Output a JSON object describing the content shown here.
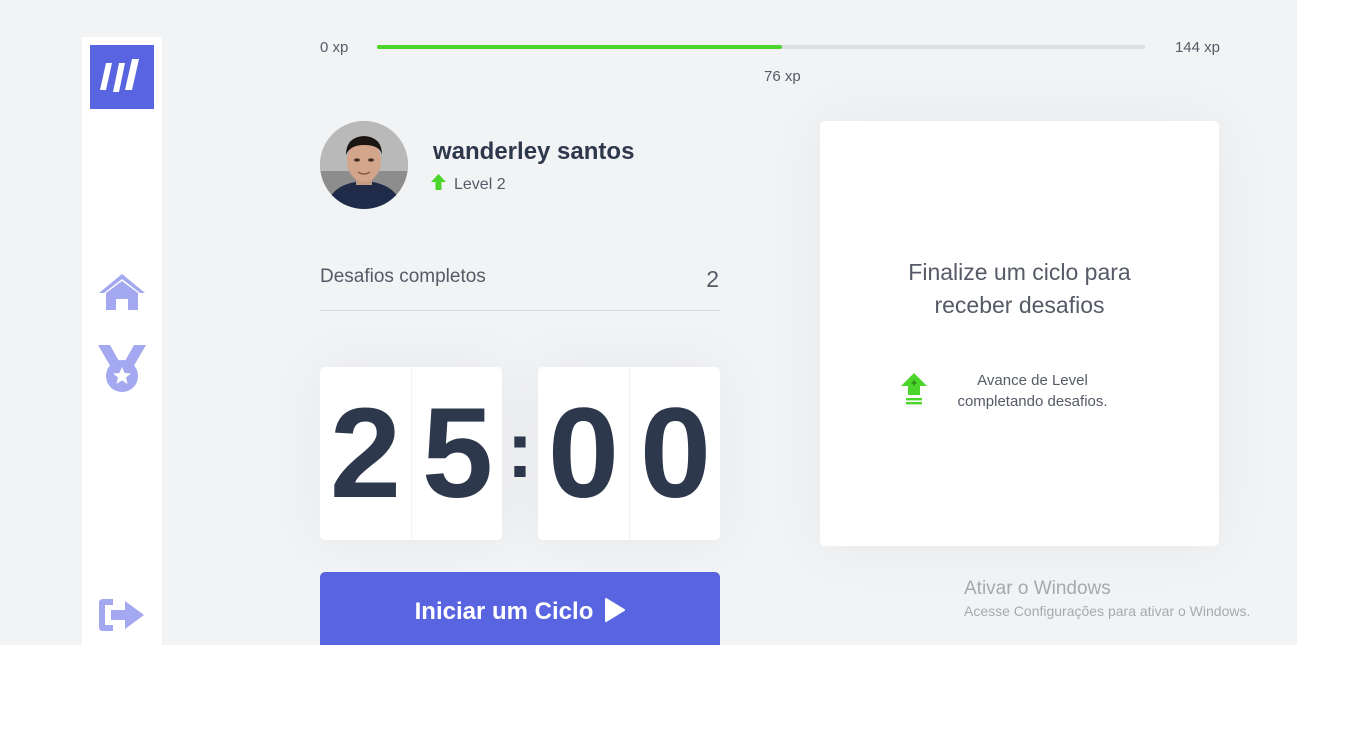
{
  "xp": {
    "min_label": "0 xp",
    "max_label": "144 xp",
    "current_label": "76 xp",
    "current": 76,
    "max": 144
  },
  "profile": {
    "name": "wanderley santos",
    "level_label": "Level 2"
  },
  "challenges": {
    "label": "Desafios completos",
    "count": "2"
  },
  "countdown": {
    "minute_left": "2",
    "minute_right": "5",
    "separator": ":",
    "second_left": "0",
    "second_right": "0"
  },
  "start_button": {
    "label": "Iniciar um Ciclo"
  },
  "challenge_box": {
    "title_line1": "Finalize um ciclo para",
    "title_line2": "receber desafios",
    "hint_line1": "Avance de Level",
    "hint_line2": "completando desafios."
  },
  "watermark": {
    "title": "Ativar o Windows",
    "subtitle": "Acesse Configurações para ativar o Windows."
  },
  "sidebar": {
    "items": [
      "home-icon",
      "award-icon"
    ],
    "bottom": "logout-icon"
  },
  "colors": {
    "accent": "#5965e0",
    "green": "#4cd62b",
    "text": "#555a66",
    "title": "#2e384d",
    "background": "#f2f3f5"
  }
}
